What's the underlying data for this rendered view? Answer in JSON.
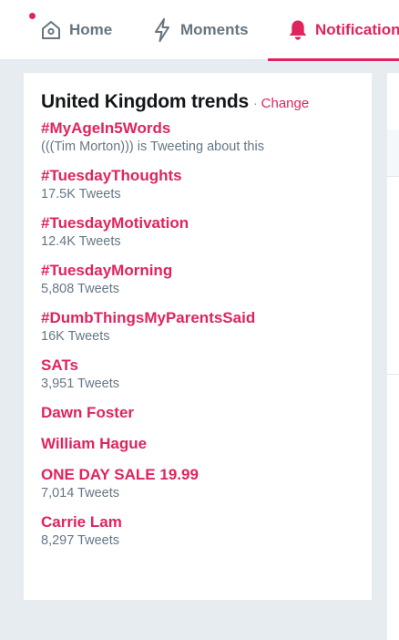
{
  "nav": {
    "home_label": "Home",
    "moments_label": "Moments",
    "notifications_label": "Notifications",
    "notification_dot_color": "#e0245e",
    "icons": {
      "home": "home-icon",
      "moments": "lightning-icon",
      "notifications": "bell-icon"
    }
  },
  "trends": {
    "title": "United Kingdom trends",
    "separator": "·",
    "change_label": "Change",
    "items": [
      {
        "name": "#MyAgeIn5Words",
        "sub": "(((Tim Morton))) is Tweeting about this"
      },
      {
        "name": "#TuesdayThoughts",
        "sub": "17.5K Tweets"
      },
      {
        "name": "#TuesdayMotivation",
        "sub": "12.4K Tweets"
      },
      {
        "name": "#TuesdayMorning",
        "sub": "5,808 Tweets"
      },
      {
        "name": "#DumbThingsMyParentsSaid",
        "sub": "16K Tweets"
      },
      {
        "name": "SATs",
        "sub": "3,951 Tweets"
      },
      {
        "name": "Dawn Foster",
        "sub": ""
      },
      {
        "name": "William Hague",
        "sub": ""
      },
      {
        "name": "ONE DAY SALE 19.99",
        "sub": "7,014 Tweets"
      },
      {
        "name": "Carrie Lam",
        "sub": "8,297 Tweets"
      }
    ]
  },
  "colors": {
    "accent": "#e0245e",
    "muted_text": "#657786",
    "title_text": "#14171a",
    "background": "#e6ecf0"
  }
}
